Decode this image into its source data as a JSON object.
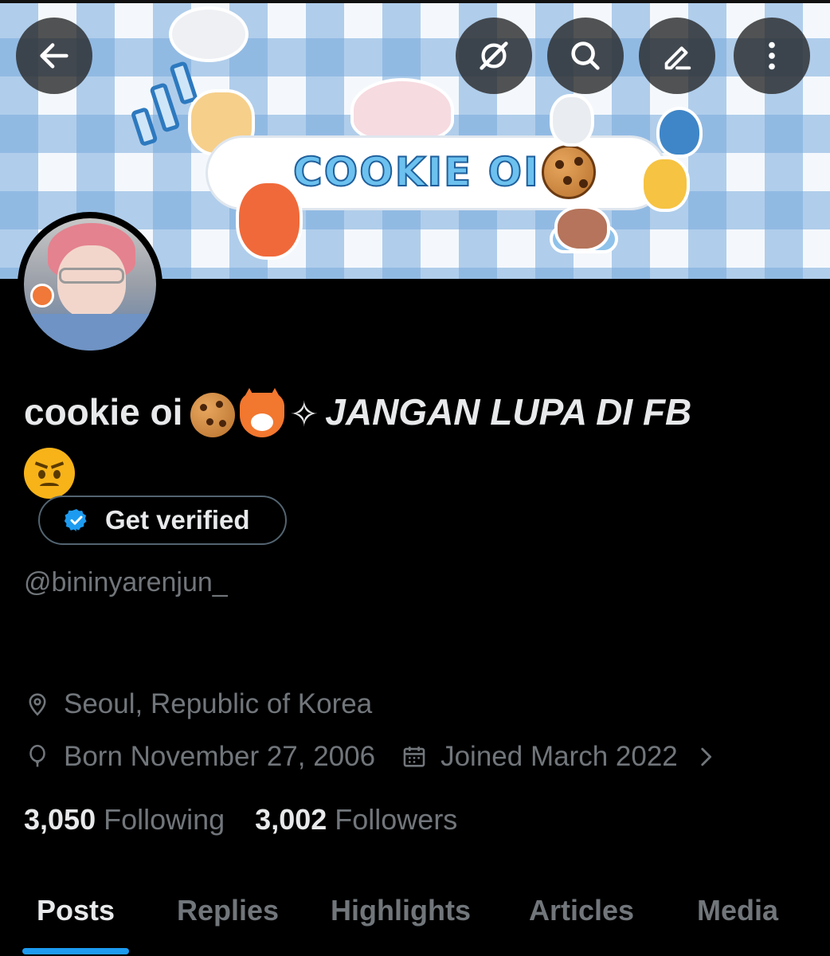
{
  "banner": {
    "title": "COOKIE OI"
  },
  "toolbar": {
    "back_icon": "arrow-left-icon",
    "grok_icon": "grok-icon",
    "search_icon": "search-icon",
    "edit_icon": "edit-icon",
    "more_icon": "more-vertical-icon"
  },
  "profile": {
    "display_name_text": "cookie oi",
    "display_name_suffix": "JANGAN LUPA DI FB",
    "name_emojis": [
      "cookie-emoji",
      "fox-emoji",
      "sparkle-emoji",
      "angry-face-emoji"
    ],
    "verify_label": "Get verified",
    "handle": "@bininyarenjun_",
    "location": "Seoul, Republic of Korea",
    "born": "Born November 27, 2006",
    "joined": "Joined March 2022"
  },
  "stats": {
    "following_count": "3,050",
    "following_label": "Following",
    "followers_count": "3,002",
    "followers_label": "Followers"
  },
  "tabs": [
    {
      "label": "Posts",
      "active": true
    },
    {
      "label": "Replies",
      "active": false
    },
    {
      "label": "Highlights",
      "active": false
    },
    {
      "label": "Articles",
      "active": false
    },
    {
      "label": "Media",
      "active": false
    }
  ],
  "colors": {
    "accent": "#1d9bf0",
    "background": "#000000",
    "text_primary": "#e7e9ea",
    "text_secondary": "#71767b"
  }
}
